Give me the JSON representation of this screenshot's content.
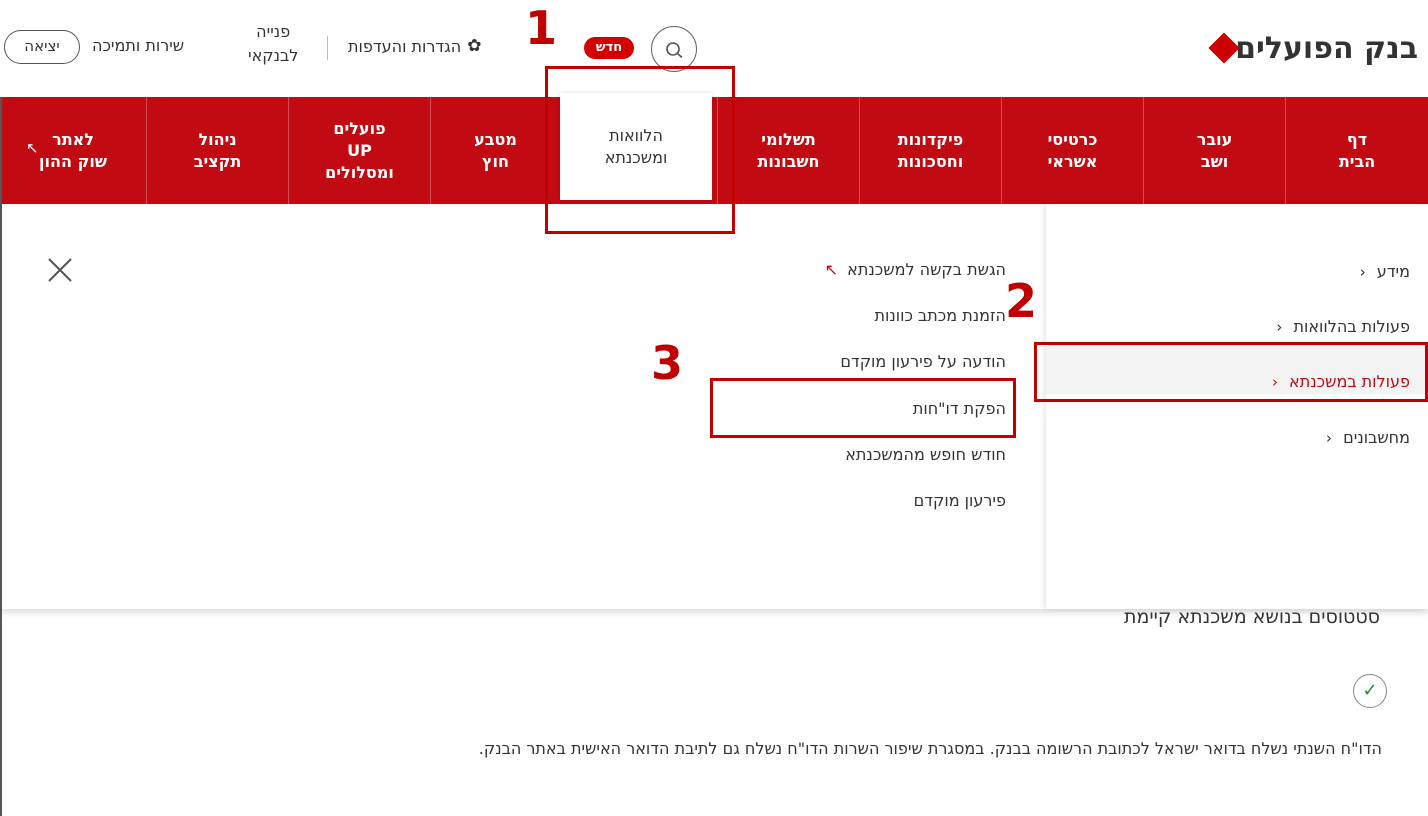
{
  "header": {
    "brand": "בנק הפועלים",
    "new_badge": "חדש",
    "settings_label": "הגדרות והעדפות",
    "contact_line1": "פנייה",
    "contact_line2": "לבנקאי",
    "support_label": "שירות ותמיכה",
    "logout_label": "יציאה"
  },
  "nav": {
    "items": [
      {
        "line1": "דף",
        "line2": "הבית"
      },
      {
        "line1": "עובר",
        "line2": "ושב"
      },
      {
        "line1": "כרטיסי",
        "line2": "אשראי"
      },
      {
        "line1": "פיקדונות",
        "line2": "וחסכונות"
      },
      {
        "line1": "תשלומי",
        "line2": "חשבונות"
      },
      {
        "line1": "הלוואות",
        "line2": "ומשכנתא"
      },
      {
        "line1": "מטבע",
        "line2": "חוץ"
      },
      {
        "line1": "פועלים",
        "line2": "UP",
        "line3": "ומסלולים"
      },
      {
        "line1": "ניהול",
        "line2": "תקציב"
      },
      {
        "line1": "לאתר",
        "line2": "שוק ההון"
      }
    ]
  },
  "dropdown": {
    "side_items": [
      {
        "label": "מידע",
        "chevron": "‹"
      },
      {
        "label": "פעולות בהלוואות",
        "chevron": "‹"
      },
      {
        "label": "פעולות במשכנתא",
        "chevron": "‹"
      },
      {
        "label": "מחשבונים",
        "chevron": "‹"
      }
    ],
    "links": [
      {
        "label": "הגשת בקשה למשכנתא",
        "external_arrow": "↖"
      },
      {
        "label": "הזמנת מכתב כוונות"
      },
      {
        "label": "הודעה על פירעון מוקדם"
      },
      {
        "label": "הפקת דו\"חות"
      },
      {
        "label": "חודש חופש מהמשכנתא"
      },
      {
        "label": "פירעון מוקדם"
      }
    ]
  },
  "content": {
    "section_title": "סטטוסים בנושא משכנתא קיימת",
    "check_glyph": "✓",
    "info_text": "הדו\"ח השנתי נשלח בדואר ישראל לכתובת הרשומה בבנק. במסגרת שיפור השרות הדו\"ח נשלח גם לתיבת הדואר האישית באתר הבנק."
  },
  "annotations": {
    "labels": [
      "1",
      "2",
      "3"
    ],
    "color": "#c00000"
  },
  "colors": {
    "brand_red": "#c20a12",
    "badge_red": "#d30000"
  },
  "icons": {
    "search": "search-icon",
    "settings": "gear-icon",
    "close": "close-icon",
    "external": "external-link-icon",
    "check": "check-icon"
  }
}
